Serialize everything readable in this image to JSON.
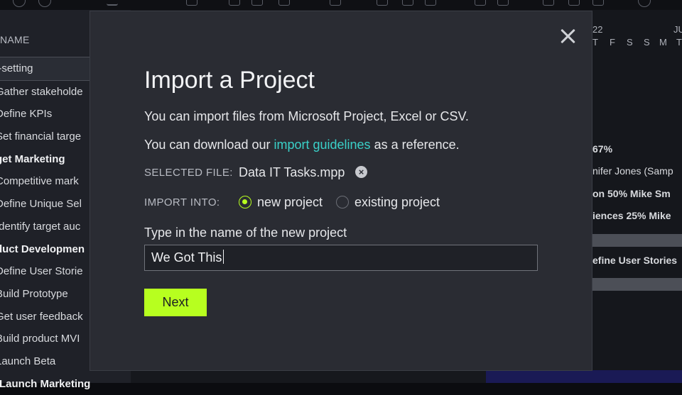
{
  "background": {
    "column_header": "NAME",
    "rows": [
      {
        "label": "l-setting",
        "bold": false,
        "selected": true
      },
      {
        "label": "Gather stakeholde",
        "bold": false
      },
      {
        "label": "Define KPIs",
        "bold": false
      },
      {
        "label": "Set financial targe",
        "bold": false
      },
      {
        "label": "get Marketing",
        "bold": true
      },
      {
        "label": "Competitive mark",
        "bold": false
      },
      {
        "label": "Define Unique Sel",
        "bold": false
      },
      {
        "label": "Identify target auc",
        "bold": false
      },
      {
        "label": "duct Developmen",
        "bold": true
      },
      {
        "label": "Define User Storie",
        "bold": false
      },
      {
        "label": "Build Prototype",
        "bold": false
      },
      {
        "label": "Get user feedback",
        "bold": false
      },
      {
        "label": "Build product MVI",
        "bold": false
      },
      {
        "label": "Launch Beta",
        "bold": false
      },
      {
        "label": "-Launch Marketing",
        "bold": true
      }
    ],
    "timeline": {
      "month_labels": [
        "22",
        "JU"
      ],
      "day_labels": [
        "T",
        "F",
        "S",
        "S",
        "M",
        "T"
      ],
      "texts": [
        "67%",
        "nifer Jones (Samp",
        "on  50%  Mike Sm",
        "iences  25%  Mike",
        "efine User Stories"
      ]
    }
  },
  "modal": {
    "title": "Import a Project",
    "intro": "You can import files from Microsoft Project, Excel or CSV.",
    "download_prefix": "You can download our ",
    "download_link": "import guidelines",
    "download_suffix": " as a reference.",
    "selected_file_label": "SELECTED FILE:",
    "selected_file_name": "Data IT Tasks.mpp",
    "import_into_label": "IMPORT INTO:",
    "options": [
      {
        "label": "new project",
        "selected": true
      },
      {
        "label": "existing project",
        "selected": false
      }
    ],
    "name_label": "Type in the name of the new project",
    "name_value": "We Got This",
    "next_label": "Next"
  },
  "colors": {
    "accent": "#b7ff1f",
    "link": "#3ad0c8",
    "modal_bg": "#2a2c33"
  }
}
